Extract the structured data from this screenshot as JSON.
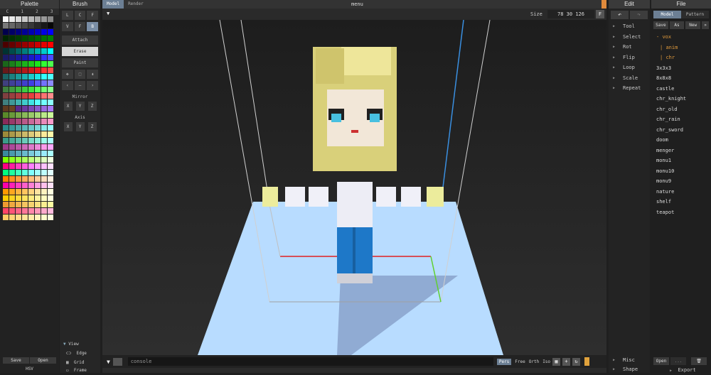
{
  "palette": {
    "title": "Palette",
    "tabs": [
      "C",
      "1",
      "2",
      "3"
    ],
    "colors": [
      "#f8f8f8",
      "#e8e8e8",
      "#d8d8d8",
      "#c8c8c8",
      "#b8b8b8",
      "#a8a8a8",
      "#989898",
      "#888888",
      "#787878",
      "#686868",
      "#585858",
      "#484848",
      "#383838",
      "#282828",
      "#181818",
      "#080808",
      "#00004c",
      "#000066",
      "#00007f",
      "#000099",
      "#0000b2",
      "#0000cc",
      "#0000e5",
      "#0000ff",
      "#002600",
      "#003300",
      "#003f00",
      "#004c00",
      "#005800",
      "#006600",
      "#007200",
      "#007f00",
      "#4c0000",
      "#660000",
      "#7f0000",
      "#990000",
      "#b20000",
      "#cc0000",
      "#e50000",
      "#ff0000",
      "#003333",
      "#004c4c",
      "#006666",
      "#007f7f",
      "#009999",
      "#00b2b2",
      "#00cccc",
      "#00ffff",
      "#1a1a66",
      "#1a1a80",
      "#1a1a99",
      "#1a1ab3",
      "#1a1acc",
      "#1a1ae6",
      "#3333ff",
      "#4d4dff",
      "#1a661a",
      "#1a801a",
      "#1a991a",
      "#1ab31a",
      "#1acc1a",
      "#1ae61a",
      "#33ff33",
      "#4dff4d",
      "#661a1a",
      "#801a1a",
      "#991a1a",
      "#b31a1a",
      "#cc1a1a",
      "#e61a1a",
      "#ff3333",
      "#ff4d4d",
      "#1a6666",
      "#1a8080",
      "#1a9999",
      "#1ab3b3",
      "#1acccc",
      "#1ae6e6",
      "#33ffff",
      "#4dffff",
      "#40407f",
      "#404099",
      "#4040b2",
      "#4040cc",
      "#4040e5",
      "#5959ff",
      "#7373ff",
      "#8c8cff",
      "#407f40",
      "#409940",
      "#40b240",
      "#40cc40",
      "#40e540",
      "#59ff59",
      "#73ff73",
      "#8cff8c",
      "#7f4040",
      "#994040",
      "#b24040",
      "#cc4040",
      "#e54040",
      "#ff5959",
      "#ff7373",
      "#ff8c8c",
      "#407f7f",
      "#409999",
      "#40b2b2",
      "#40cccc",
      "#40e5e5",
      "#59ffff",
      "#73ffff",
      "#8cffff",
      "#5f3a1f",
      "#6a4424",
      "#5a2a8a",
      "#6a3aa0",
      "#7a4ab5",
      "#8a5acb",
      "#9a6ae0",
      "#aa7af5",
      "#5a8a2a",
      "#6a9a3a",
      "#7aaa4a",
      "#8aba5a",
      "#9aca6a",
      "#aada7a",
      "#bbea8a",
      "#ccfa9a",
      "#8a2a5a",
      "#9a3a6a",
      "#aa4a7a",
      "#ba5a8a",
      "#ca6a9a",
      "#da7aaa",
      "#ea8aba",
      "#fa9aca",
      "#2a8a8a",
      "#3a9a9a",
      "#4aaaaa",
      "#5ababa",
      "#6acaca",
      "#7adada",
      "#8aeaea",
      "#9afafa",
      "#9c8a3a",
      "#ac9a4a",
      "#bcaa5a",
      "#ccba6a",
      "#dcca7a",
      "#ecda8a",
      "#fcea9a",
      "#fffaaa",
      "#3a9c8a",
      "#4aac9a",
      "#5abcaa",
      "#6accba",
      "#7adcca",
      "#8aecda",
      "#9afcea",
      "#aaffff",
      "#9c3a8a",
      "#ac4a9a",
      "#bc5aaa",
      "#cc6aba",
      "#dc7aca",
      "#ec8ada",
      "#fc9aea",
      "#ffaaff",
      "#3a8a9c",
      "#4a9aac",
      "#5aaabc",
      "#6abacc",
      "#7acadc",
      "#8adaec",
      "#9aeafc",
      "#aaffff",
      "#7fff00",
      "#8fff20",
      "#9fff40",
      "#afff60",
      "#bfff80",
      "#cfffa0",
      "#dfffc0",
      "#efffe0",
      "#ff007f",
      "#ff209f",
      "#ff40bf",
      "#ff60df",
      "#ff80ff",
      "#ffa0ff",
      "#ffc0ff",
      "#ffe0ff",
      "#00ff7f",
      "#20ff9f",
      "#40ffbf",
      "#60ffdf",
      "#80ffff",
      "#a0ffff",
      "#c0ffff",
      "#e0ffff",
      "#ff7f00",
      "#ff8f20",
      "#ff9f40",
      "#ffaf60",
      "#ffbf80",
      "#ffcfa0",
      "#ffdfc0",
      "#ffefe0",
      "#ff00aa",
      "#ff20b5",
      "#ff40c0",
      "#ff60cb",
      "#ff80d6",
      "#ffa0e1",
      "#ffc0ec",
      "#ffe0f7",
      "#ff9900",
      "#ffa820",
      "#ffb740",
      "#ffc660",
      "#ffd580",
      "#ffe4a0",
      "#fff3c0",
      "#ffffe0",
      "#ffcc00",
      "#ffd420",
      "#ffdc40",
      "#ffe460",
      "#ffec80",
      "#fff4a0",
      "#fffcc0",
      "#ffffe0",
      "#ee9a30",
      "#f0a840",
      "#f2b650",
      "#f4c460",
      "#f6d270",
      "#f8e080",
      "#faee90",
      "#fcfca0",
      "#ff4466",
      "#ff5577",
      "#ff6688",
      "#ff7799",
      "#ff88aa",
      "#ff99bb",
      "#ffaacc",
      "#ffbbdd",
      "#ffcc66",
      "#ffd477",
      "#ffdc88",
      "#ffe499",
      "#ffecaa",
      "#fff4bb",
      "#fffccc",
      "#ffffdd"
    ],
    "save_label": "Save",
    "open_label": "Open",
    "hsv_label": "HSV"
  },
  "brush": {
    "title": "Brush",
    "shapes": [
      "L",
      "C",
      "F"
    ],
    "shapes2": [
      "V",
      "F",
      "B"
    ],
    "modes": [
      "Attach",
      "Erase",
      "Paint"
    ],
    "mirror_label": "Mirror",
    "axis_label": "Axis",
    "xyz": [
      "X",
      "Y",
      "Z"
    ],
    "view_label": "View",
    "edge_label": "Edge",
    "grid_label": "Grid",
    "frame_label": "Frame"
  },
  "viewport": {
    "tabs": [
      "Model",
      "Render"
    ],
    "menu_label": "menu",
    "size_label": "Size",
    "size_value": "78 30 126",
    "f_label": "F",
    "console_placeholder": "console",
    "modes": [
      "Pers",
      "Free",
      "Orth",
      "Iso"
    ]
  },
  "edit": {
    "title": "Edit",
    "items": [
      "Tool",
      "Select",
      "Rot",
      "Flip",
      "Loop",
      "Scale",
      "Repeat"
    ],
    "misc_label": "Misc",
    "shape_label": "Shape"
  },
  "file": {
    "title": "File",
    "tabs": [
      "Model",
      "Pattern"
    ],
    "ops": [
      "Save",
      "As",
      "New"
    ],
    "items": [
      "vox",
      "anim",
      "chr",
      "3x3x3",
      "8x8x8",
      "castle",
      "chr_knight",
      "chr_old",
      "chr_rain",
      "chr_sword",
      "doom",
      "menger",
      "monu1",
      "monu10",
      "monu9",
      "nature",
      "shelf",
      "teapot"
    ],
    "open_label": "Open",
    "dots_label": "...",
    "export_label": "Export"
  },
  "colors": {
    "accent_tab": "#6c7f94",
    "orange": "#e08a3c",
    "floor": "#b8dcff"
  }
}
